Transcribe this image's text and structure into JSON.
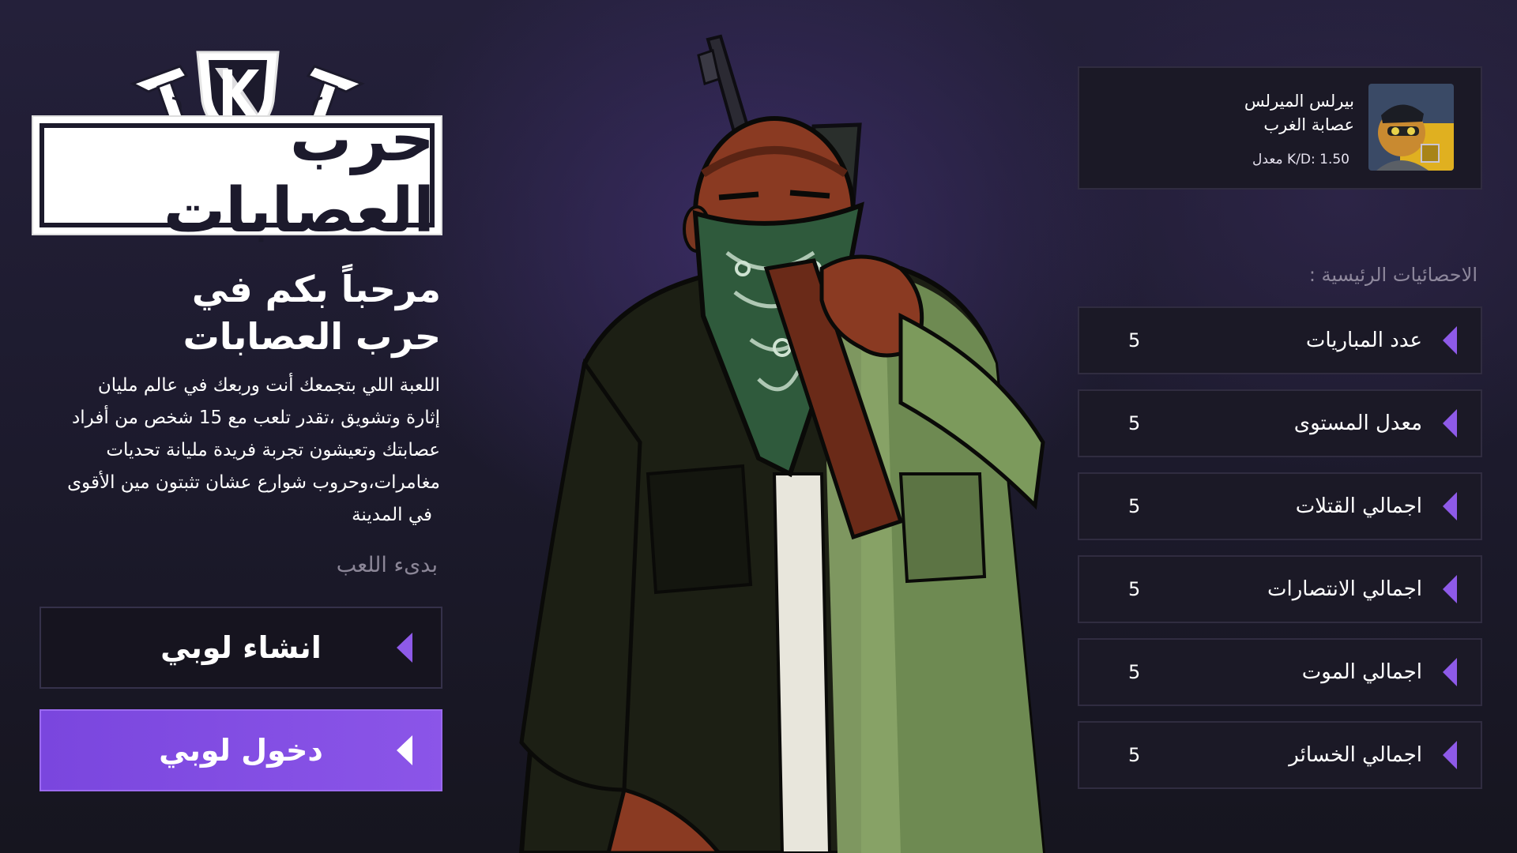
{
  "logo": {
    "text": "حرب العصابات"
  },
  "welcome": {
    "line1": "مرحباً بكم في",
    "line2": "حرب العصابات"
  },
  "description": [
    "اللعبة اللي بتجمعك أنت وربعك في عالم مليان",
    "إثارة وتشويق ،تقدر تلعب مع 15 شخص من أفراد",
    "عصابتك وتعيشون تجربة فريدة مليانة تحديات",
    "مغامرات،وحروب شوارع عشان تثبتون مين الأقوى",
    "في المدينة"
  ],
  "start_label": "بدىء اللعب",
  "buttons": {
    "create_lobby": "انشاء لوبي",
    "join_lobby": "دخول لوبي"
  },
  "profile": {
    "name": "بيرلس الميرلس",
    "gang": "عصابة الغرب",
    "kd": "K/D: 1.50 معدل"
  },
  "stats_title": "الاحصائيات الرئيسية :",
  "stats": [
    {
      "label": "عدد المباريات",
      "value": "5"
    },
    {
      "label": "معدل المستوى",
      "value": "5"
    },
    {
      "label": "اجمالي القتلات",
      "value": "5"
    },
    {
      "label": "اجمالي الانتصارات",
      "value": "5"
    },
    {
      "label": "اجمالي الموت",
      "value": "5"
    },
    {
      "label": "اجمالي الخسائر",
      "value": "5"
    }
  ],
  "colors": {
    "accent": "#8b55e8",
    "panel": "#1b1926",
    "panel_border": "#302c40",
    "background": "#1c1a2c"
  },
  "icons": {
    "stat_arrow": "triangle-left-icon",
    "button_arrow": "triangle-left-icon"
  }
}
